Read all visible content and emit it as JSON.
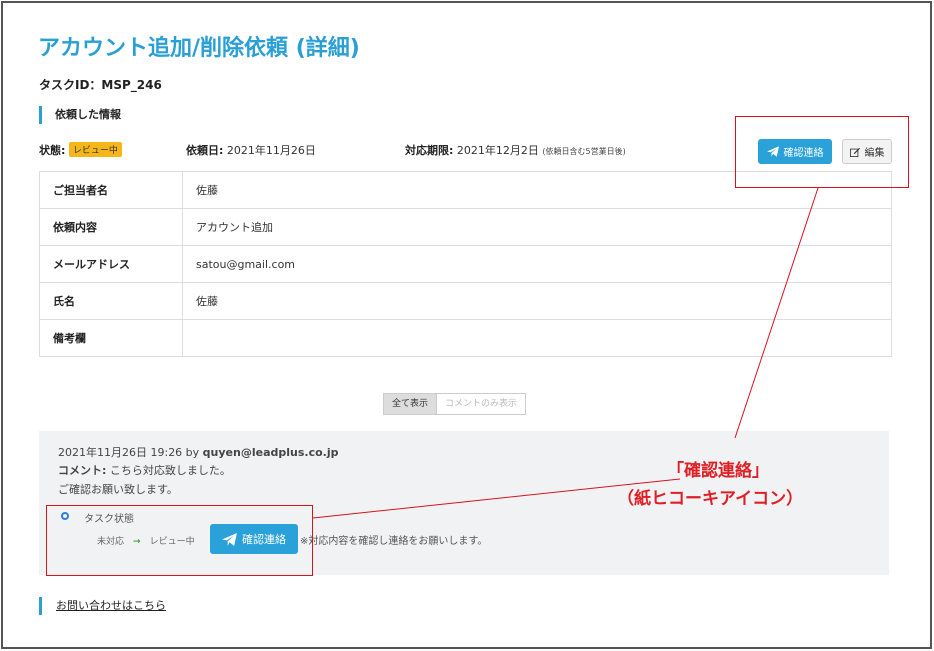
{
  "page": {
    "title": "アカウント追加/削除依頼 (詳細)",
    "task_id": "タスクID：MSP_246"
  },
  "section": {
    "heading": "依頼した情報"
  },
  "meta": {
    "status_label": "状態:",
    "status_badge": "レビュー中",
    "request_date_label": "依頼日:",
    "request_date": "2021年11月26日",
    "deadline_label": "対応期限:",
    "deadline": "2021年12月2日",
    "deadline_note": "(依頼日含む5営業日後)"
  },
  "actions": {
    "confirm_label": "確認連絡",
    "edit_label": "編集"
  },
  "details": [
    {
      "key": "ご担当者名",
      "value": "佐藤"
    },
    {
      "key": "依頼内容",
      "value": "アカウント追加"
    },
    {
      "key": "メールアドレス",
      "value": "satou@gmail.com"
    },
    {
      "key": "氏名",
      "value": "佐藤"
    },
    {
      "key": "備考欄",
      "value": ""
    }
  ],
  "filter": {
    "all_label": "全て表示",
    "comments_label": "コメントのみ表示"
  },
  "comment": {
    "header_prefix": "2021年11月26日 19:26 by ",
    "author": "quyen@leadplus.co.jp",
    "comment_label": "コメント:",
    "comment_text": "こちら対応致しました。",
    "comment_text_2": "ご確認お願い致します。",
    "status_title": "タスク状態",
    "status_from": "未対応",
    "status_to": "レビュー中",
    "confirm_label": "確認連絡",
    "note": "※対応内容を確認し連絡をお願いします。"
  },
  "footer": {
    "contact_link": "お問い合わせはこちら"
  },
  "annotation": {
    "line1": "「確認連絡」",
    "line2": "（紙ヒコーキアイコン）"
  },
  "colors": {
    "accent": "#2a9fd6",
    "badge": "#f5b718",
    "annotation_red": "#e01f24"
  }
}
